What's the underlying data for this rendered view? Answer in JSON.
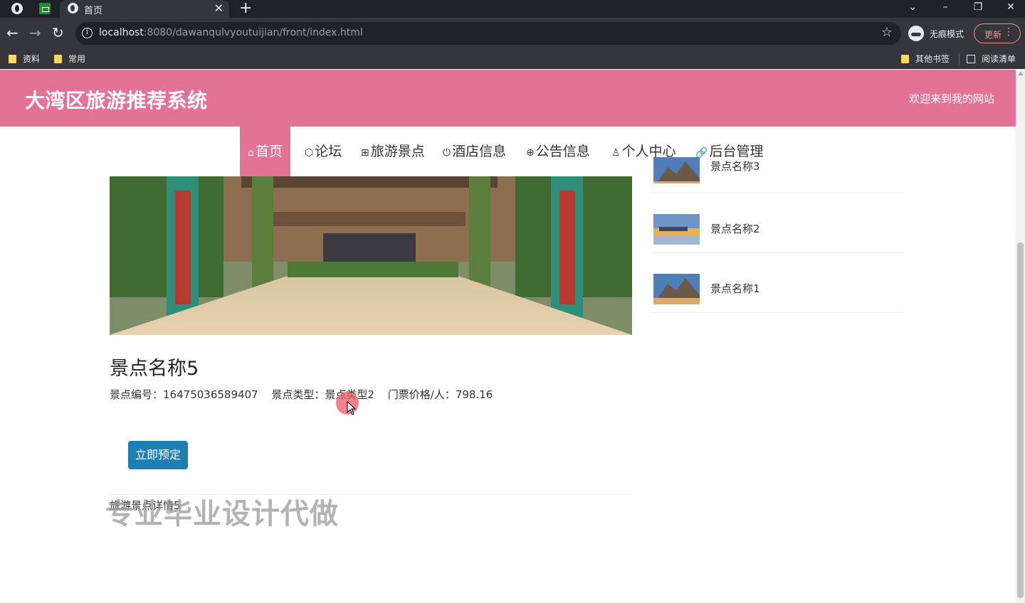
{
  "browser": {
    "tab_title": "首页",
    "tab_close": "✕",
    "new_tab": "+",
    "url_host": "localhost",
    "url_rest": ":8080/dawanqulvyoutuijian/front/index.html",
    "incognito_label": "无痕模式",
    "update_label": "更新",
    "bookmarks": [
      "资料",
      "常用"
    ],
    "other_bookmarks": "其他书签",
    "reading_list": "阅读清单",
    "icons": [
      "globe-icon",
      "sheets-icon",
      "back-icon",
      "forward-icon",
      "reload-icon",
      "info-icon",
      "star-icon",
      "incognito-icon",
      "kebab-menu-icon",
      "folder-icon",
      "reading-list-icon"
    ]
  },
  "site": {
    "title": "大湾区旅游推荐系统",
    "welcome": "欢迎来到我的网站",
    "header_color": "#e27396"
  },
  "nav": {
    "items": [
      {
        "label": "首页",
        "icon": "home-icon",
        "active": true
      },
      {
        "label": "论坛",
        "icon": "cube-icon"
      },
      {
        "label": "旅游景点",
        "icon": "gift-icon"
      },
      {
        "label": "酒店信息",
        "icon": "power-icon"
      },
      {
        "label": "公告信息",
        "icon": "globe-icon"
      },
      {
        "label": "个人中心",
        "icon": "user-icon"
      },
      {
        "label": "后台管理",
        "icon": "link-icon"
      }
    ]
  },
  "detail": {
    "name": "景点名称5",
    "code_label": "景点编号：",
    "code_value": "16475036589407",
    "type_label": "景点类型：",
    "type_value": "景点类型2",
    "price_label": "门票价格/人：",
    "price_value": "798.16",
    "book_button": "立即预定",
    "detail_text": "旅游景点详情5",
    "button_color": "#1f7fb0"
  },
  "side_list": [
    {
      "label": "景点名称3"
    },
    {
      "label": "景点名称2"
    },
    {
      "label": "景点名称1"
    }
  ],
  "watermark": "专业毕业设计代做"
}
